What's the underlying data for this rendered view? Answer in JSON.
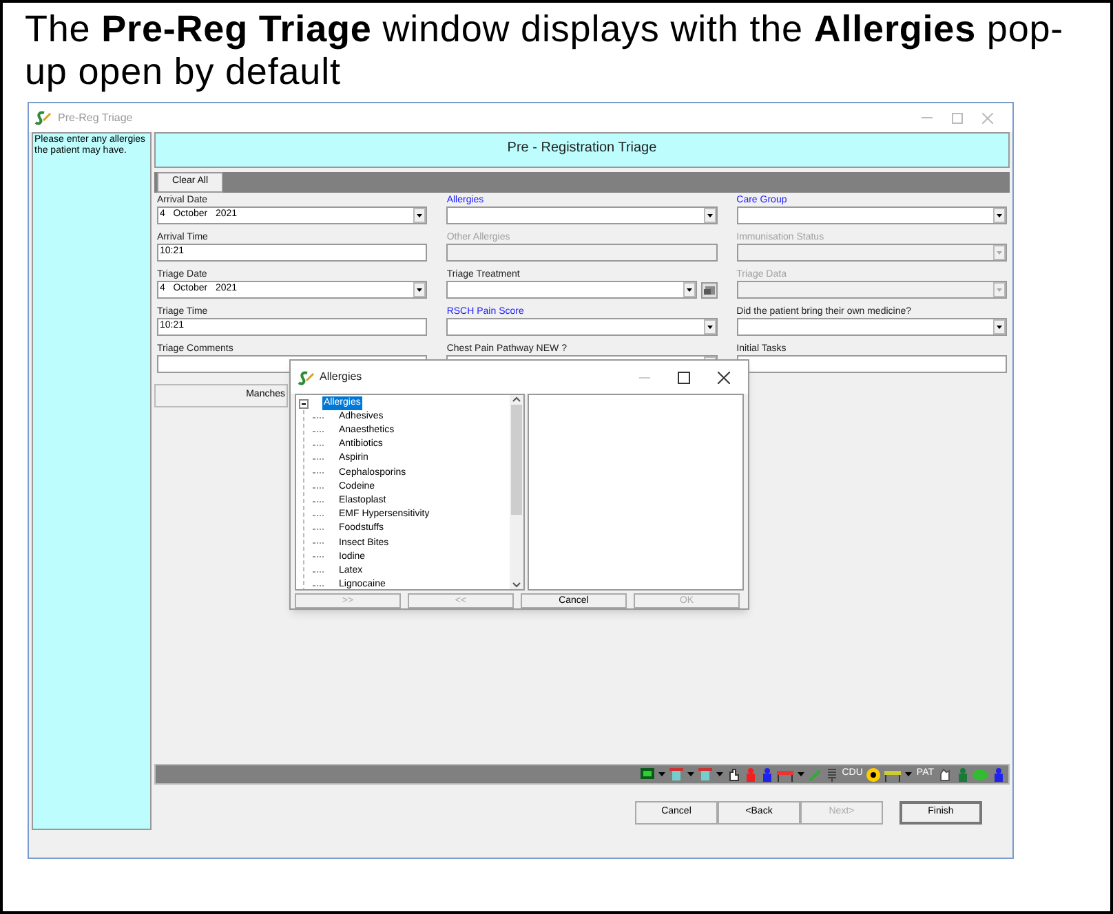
{
  "caption": "The **Pre-Reg Triage** window displays with the **Allergies** pop-up open by default",
  "window": {
    "title": "Pre-Reg Triage"
  },
  "help_text": "Please enter any allergies the patient may have.",
  "header": "Pre - Registration Triage",
  "clear_button": "Clear All",
  "form_columns": [
    [
      {
        "label": "Arrival Date",
        "kind": "dropdown",
        "value": "4   October   2021",
        "required": false,
        "disabled": false
      },
      {
        "label": "Arrival Time",
        "kind": "text",
        "value": "10:21",
        "required": false,
        "disabled": false
      },
      {
        "label": "Triage Date",
        "kind": "dropdown",
        "value": "4   October   2021",
        "required": false,
        "disabled": false
      },
      {
        "label": "Triage Time",
        "kind": "text",
        "value": "10:21",
        "required": false,
        "disabled": false
      },
      {
        "label": "Triage Comments",
        "kind": "text",
        "required": false,
        "disabled": false
      }
    ],
    [
      {
        "label": "Allergies",
        "kind": "dropdown",
        "required": true,
        "disabled": false
      },
      {
        "label": "Other Allergies",
        "kind": "text",
        "required": false,
        "disabled": true
      },
      {
        "label": "Triage Treatment",
        "kind": "dropdown_button",
        "required": false,
        "disabled": false
      },
      {
        "label": "RSCH Pain Score",
        "kind": "dropdown",
        "required": true,
        "disabled": false
      },
      {
        "label": "Chest Pain Pathway NEW ?",
        "kind": "dropdown",
        "required": false,
        "disabled": false
      }
    ],
    [
      {
        "label": "Care Group",
        "kind": "dropdown",
        "required": true,
        "disabled": false
      },
      {
        "label": "Immunisation Status",
        "kind": "dropdown",
        "required": false,
        "disabled": true
      },
      {
        "label": "Triage Data",
        "kind": "dropdown",
        "required": false,
        "disabled": true
      },
      {
        "label": "Did the patient bring their own medicine?",
        "kind": "dropdown",
        "required": false,
        "disabled": false
      },
      {
        "label": "Initial Tasks",
        "kind": "text",
        "required": false,
        "disabled": false
      }
    ]
  ],
  "manchester_button": "Manches",
  "toolbar_labels": [
    "CDU",
    "PAT"
  ],
  "footer_buttons": [
    {
      "label": "Cancel",
      "disabled": false,
      "default": false
    },
    {
      "label": "<Back",
      "disabled": false,
      "default": false
    },
    {
      "label": "Next>",
      "disabled": true,
      "default": false
    },
    {
      "label": "Finish",
      "disabled": false,
      "default": true
    }
  ],
  "dialog": {
    "title": "Allergies",
    "tree": {
      "label": "Allergies",
      "selected": true,
      "expanded": true,
      "children": [
        {
          "label": "Adhesives",
          "selected": false
        },
        {
          "label": "Anaesthetics",
          "selected": false
        },
        {
          "label": "Antibiotics",
          "selected": false
        },
        {
          "label": "Aspirin",
          "selected": false
        },
        {
          "label": "Cephalosporins",
          "selected": false
        },
        {
          "label": "Codeine",
          "selected": false
        },
        {
          "label": "Elastoplast",
          "selected": false
        },
        {
          "label": "EMF Hypersensitivity",
          "selected": false
        },
        {
          "label": "Foodstuffs",
          "selected": false
        },
        {
          "label": "Insect Bites",
          "selected": false
        },
        {
          "label": "Iodine",
          "selected": false
        },
        {
          "label": "Latex",
          "selected": false
        },
        {
          "label": "Lignocaine",
          "selected": false
        }
      ]
    },
    "buttons": [
      {
        "label": ">>",
        "disabled": true
      },
      {
        "label": "<<",
        "disabled": true
      },
      {
        "label": "Cancel",
        "disabled": false
      },
      {
        "label": "OK",
        "disabled": true
      }
    ]
  }
}
